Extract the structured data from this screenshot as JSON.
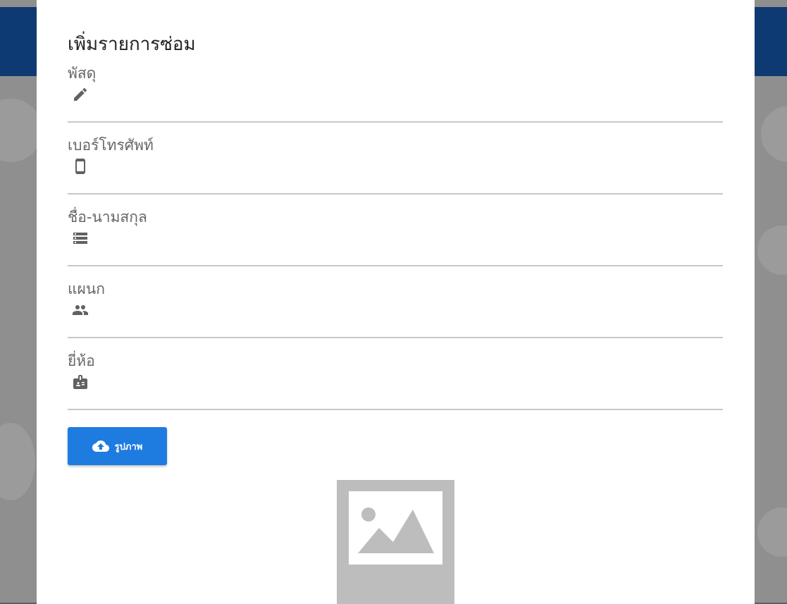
{
  "dialog": {
    "title": "เพิ่มรายการซ่อม"
  },
  "fields": [
    {
      "label": "พัสดุ",
      "icon": "pencil-icon",
      "value": ""
    },
    {
      "label": "เบอร์โทรศัพท์",
      "icon": "mobile-phone-icon",
      "value": ""
    },
    {
      "label": "ชื่อ-นามสกุล",
      "icon": "storage-icon",
      "value": ""
    },
    {
      "label": "แผนก",
      "icon": "people-icon",
      "value": ""
    },
    {
      "label": "ยี่ห้อ",
      "icon": "badge-icon",
      "value": ""
    }
  ],
  "upload": {
    "label": "รูปภาพ",
    "icon": "cloud-upload-icon"
  },
  "image_preview": {
    "icon": "image-placeholder-icon"
  },
  "colors": {
    "primary": "#1e7be0",
    "header_bar": "#0d3a73",
    "backdrop": "#8f8f8f",
    "label_text": "#666666",
    "underline": "#c8c8c8",
    "icon": "#616161",
    "placeholder_image": "#bdbdbd"
  }
}
